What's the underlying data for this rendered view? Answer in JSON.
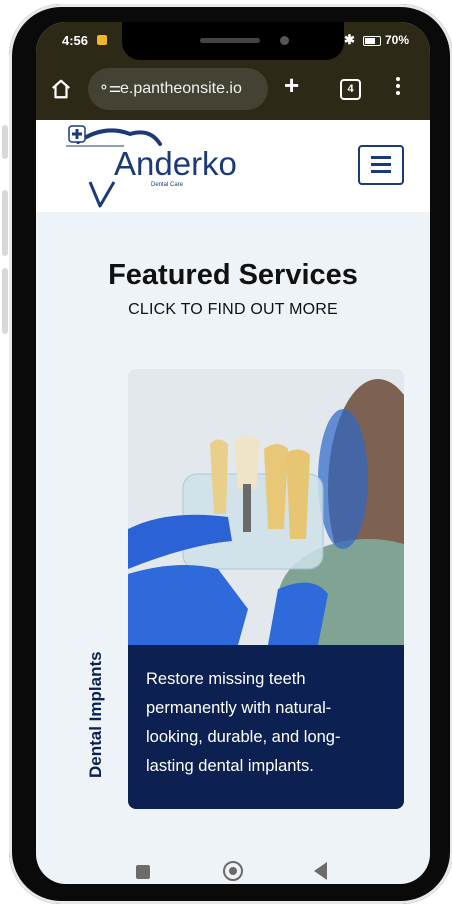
{
  "status_bar": {
    "time": "4:56",
    "battery": "70%"
  },
  "browser": {
    "url": "e.pantheonsite.io",
    "tab_count": "4"
  },
  "header": {
    "logo_name": "Anderko",
    "logo_tagline": "Dental Care"
  },
  "featured": {
    "title": "Featured Services",
    "subtitle": "CLICK TO FIND OUT MORE"
  },
  "service_card": {
    "label": "Dental Implants",
    "description": "Restore missing teeth permanently with natural-looking, durable, and long-lasting dental implants."
  },
  "colors": {
    "brand_navy": "#0c2152",
    "logo_blue": "#1b3a7a",
    "browser_bar": "#2c2a17"
  },
  "icons": [
    "home-icon",
    "site-settings-icon",
    "new-tab-icon",
    "tab-switcher-icon",
    "more-menu-icon",
    "hamburger-menu-icon",
    "recents-nav-icon",
    "home-nav-icon",
    "back-nav-icon"
  ]
}
